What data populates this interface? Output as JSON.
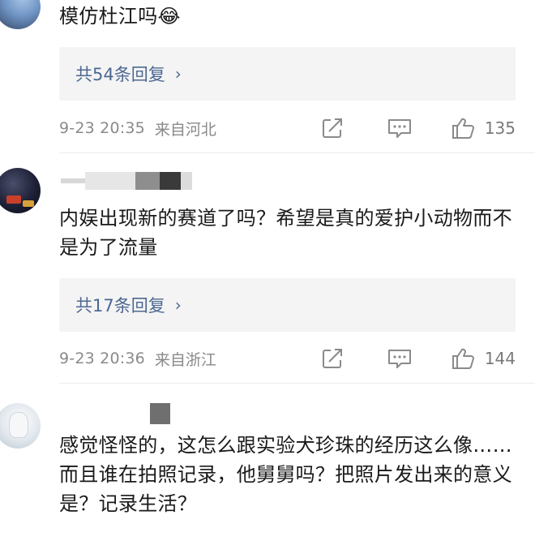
{
  "comments": [
    {
      "text": "模仿杜江吗",
      "emoji": "😂",
      "replies_label": "共54条回复",
      "time": "9-23 20:35",
      "location": "来自河北",
      "likes": "135"
    },
    {
      "text": "内娱出现新的赛道了吗？希望是真的爱护小动物而不是为了流量",
      "replies_label": "共17条回复",
      "time": "9-23 20:36",
      "location": "来自浙江",
      "likes": "144"
    },
    {
      "text": "感觉怪怪的，这怎么跟实验犬珍珠的经历这么像……而且谁在拍照记录，他舅舅吗？把照片发出来的意义是？记录生活？"
    }
  ],
  "icons": {
    "share": "share-icon",
    "comment": "comment-icon",
    "like": "thumbs-up-icon",
    "chevron": "chevron-right-icon"
  },
  "colors": {
    "link": "#4d6891",
    "meta": "#8a8a8a",
    "reply_bg": "#f4f4f4"
  }
}
